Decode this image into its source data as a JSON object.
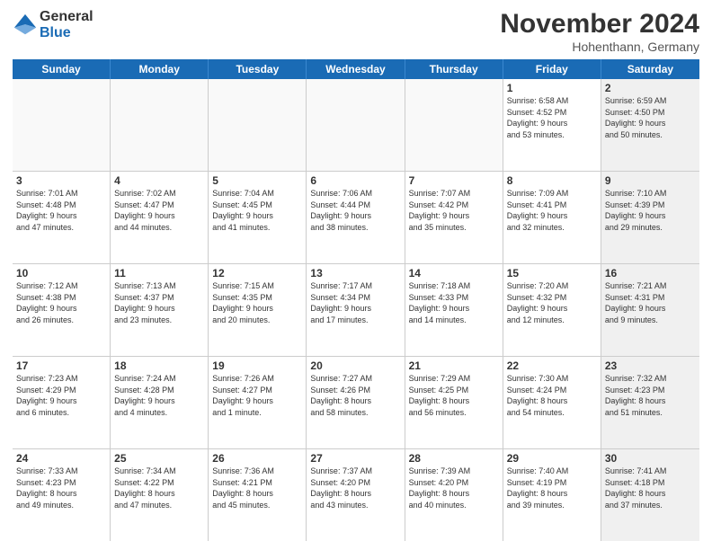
{
  "header": {
    "logo_line1": "General",
    "logo_line2": "Blue",
    "month": "November 2024",
    "location": "Hohenthann, Germany"
  },
  "days_of_week": [
    "Sunday",
    "Monday",
    "Tuesday",
    "Wednesday",
    "Thursday",
    "Friday",
    "Saturday"
  ],
  "weeks": [
    [
      {
        "day": "",
        "info": "",
        "empty": true
      },
      {
        "day": "",
        "info": "",
        "empty": true
      },
      {
        "day": "",
        "info": "",
        "empty": true
      },
      {
        "day": "",
        "info": "",
        "empty": true
      },
      {
        "day": "",
        "info": "",
        "empty": true
      },
      {
        "day": "1",
        "info": "Sunrise: 6:58 AM\nSunset: 4:52 PM\nDaylight: 9 hours\nand 53 minutes.",
        "empty": false,
        "shaded": false
      },
      {
        "day": "2",
        "info": "Sunrise: 6:59 AM\nSunset: 4:50 PM\nDaylight: 9 hours\nand 50 minutes.",
        "empty": false,
        "shaded": true
      }
    ],
    [
      {
        "day": "3",
        "info": "Sunrise: 7:01 AM\nSunset: 4:48 PM\nDaylight: 9 hours\nand 47 minutes.",
        "empty": false,
        "shaded": false
      },
      {
        "day": "4",
        "info": "Sunrise: 7:02 AM\nSunset: 4:47 PM\nDaylight: 9 hours\nand 44 minutes.",
        "empty": false,
        "shaded": false
      },
      {
        "day": "5",
        "info": "Sunrise: 7:04 AM\nSunset: 4:45 PM\nDaylight: 9 hours\nand 41 minutes.",
        "empty": false,
        "shaded": false
      },
      {
        "day": "6",
        "info": "Sunrise: 7:06 AM\nSunset: 4:44 PM\nDaylight: 9 hours\nand 38 minutes.",
        "empty": false,
        "shaded": false
      },
      {
        "day": "7",
        "info": "Sunrise: 7:07 AM\nSunset: 4:42 PM\nDaylight: 9 hours\nand 35 minutes.",
        "empty": false,
        "shaded": false
      },
      {
        "day": "8",
        "info": "Sunrise: 7:09 AM\nSunset: 4:41 PM\nDaylight: 9 hours\nand 32 minutes.",
        "empty": false,
        "shaded": false
      },
      {
        "day": "9",
        "info": "Sunrise: 7:10 AM\nSunset: 4:39 PM\nDaylight: 9 hours\nand 29 minutes.",
        "empty": false,
        "shaded": true
      }
    ],
    [
      {
        "day": "10",
        "info": "Sunrise: 7:12 AM\nSunset: 4:38 PM\nDaylight: 9 hours\nand 26 minutes.",
        "empty": false,
        "shaded": false
      },
      {
        "day": "11",
        "info": "Sunrise: 7:13 AM\nSunset: 4:37 PM\nDaylight: 9 hours\nand 23 minutes.",
        "empty": false,
        "shaded": false
      },
      {
        "day": "12",
        "info": "Sunrise: 7:15 AM\nSunset: 4:35 PM\nDaylight: 9 hours\nand 20 minutes.",
        "empty": false,
        "shaded": false
      },
      {
        "day": "13",
        "info": "Sunrise: 7:17 AM\nSunset: 4:34 PM\nDaylight: 9 hours\nand 17 minutes.",
        "empty": false,
        "shaded": false
      },
      {
        "day": "14",
        "info": "Sunrise: 7:18 AM\nSunset: 4:33 PM\nDaylight: 9 hours\nand 14 minutes.",
        "empty": false,
        "shaded": false
      },
      {
        "day": "15",
        "info": "Sunrise: 7:20 AM\nSunset: 4:32 PM\nDaylight: 9 hours\nand 12 minutes.",
        "empty": false,
        "shaded": false
      },
      {
        "day": "16",
        "info": "Sunrise: 7:21 AM\nSunset: 4:31 PM\nDaylight: 9 hours\nand 9 minutes.",
        "empty": false,
        "shaded": true
      }
    ],
    [
      {
        "day": "17",
        "info": "Sunrise: 7:23 AM\nSunset: 4:29 PM\nDaylight: 9 hours\nand 6 minutes.",
        "empty": false,
        "shaded": false
      },
      {
        "day": "18",
        "info": "Sunrise: 7:24 AM\nSunset: 4:28 PM\nDaylight: 9 hours\nand 4 minutes.",
        "empty": false,
        "shaded": false
      },
      {
        "day": "19",
        "info": "Sunrise: 7:26 AM\nSunset: 4:27 PM\nDaylight: 9 hours\nand 1 minute.",
        "empty": false,
        "shaded": false
      },
      {
        "day": "20",
        "info": "Sunrise: 7:27 AM\nSunset: 4:26 PM\nDaylight: 8 hours\nand 58 minutes.",
        "empty": false,
        "shaded": false
      },
      {
        "day": "21",
        "info": "Sunrise: 7:29 AM\nSunset: 4:25 PM\nDaylight: 8 hours\nand 56 minutes.",
        "empty": false,
        "shaded": false
      },
      {
        "day": "22",
        "info": "Sunrise: 7:30 AM\nSunset: 4:24 PM\nDaylight: 8 hours\nand 54 minutes.",
        "empty": false,
        "shaded": false
      },
      {
        "day": "23",
        "info": "Sunrise: 7:32 AM\nSunset: 4:23 PM\nDaylight: 8 hours\nand 51 minutes.",
        "empty": false,
        "shaded": true
      }
    ],
    [
      {
        "day": "24",
        "info": "Sunrise: 7:33 AM\nSunset: 4:23 PM\nDaylight: 8 hours\nand 49 minutes.",
        "empty": false,
        "shaded": false
      },
      {
        "day": "25",
        "info": "Sunrise: 7:34 AM\nSunset: 4:22 PM\nDaylight: 8 hours\nand 47 minutes.",
        "empty": false,
        "shaded": false
      },
      {
        "day": "26",
        "info": "Sunrise: 7:36 AM\nSunset: 4:21 PM\nDaylight: 8 hours\nand 45 minutes.",
        "empty": false,
        "shaded": false
      },
      {
        "day": "27",
        "info": "Sunrise: 7:37 AM\nSunset: 4:20 PM\nDaylight: 8 hours\nand 43 minutes.",
        "empty": false,
        "shaded": false
      },
      {
        "day": "28",
        "info": "Sunrise: 7:39 AM\nSunset: 4:20 PM\nDaylight: 8 hours\nand 40 minutes.",
        "empty": false,
        "shaded": false
      },
      {
        "day": "29",
        "info": "Sunrise: 7:40 AM\nSunset: 4:19 PM\nDaylight: 8 hours\nand 39 minutes.",
        "empty": false,
        "shaded": false
      },
      {
        "day": "30",
        "info": "Sunrise: 7:41 AM\nSunset: 4:18 PM\nDaylight: 8 hours\nand 37 minutes.",
        "empty": false,
        "shaded": true
      }
    ]
  ]
}
